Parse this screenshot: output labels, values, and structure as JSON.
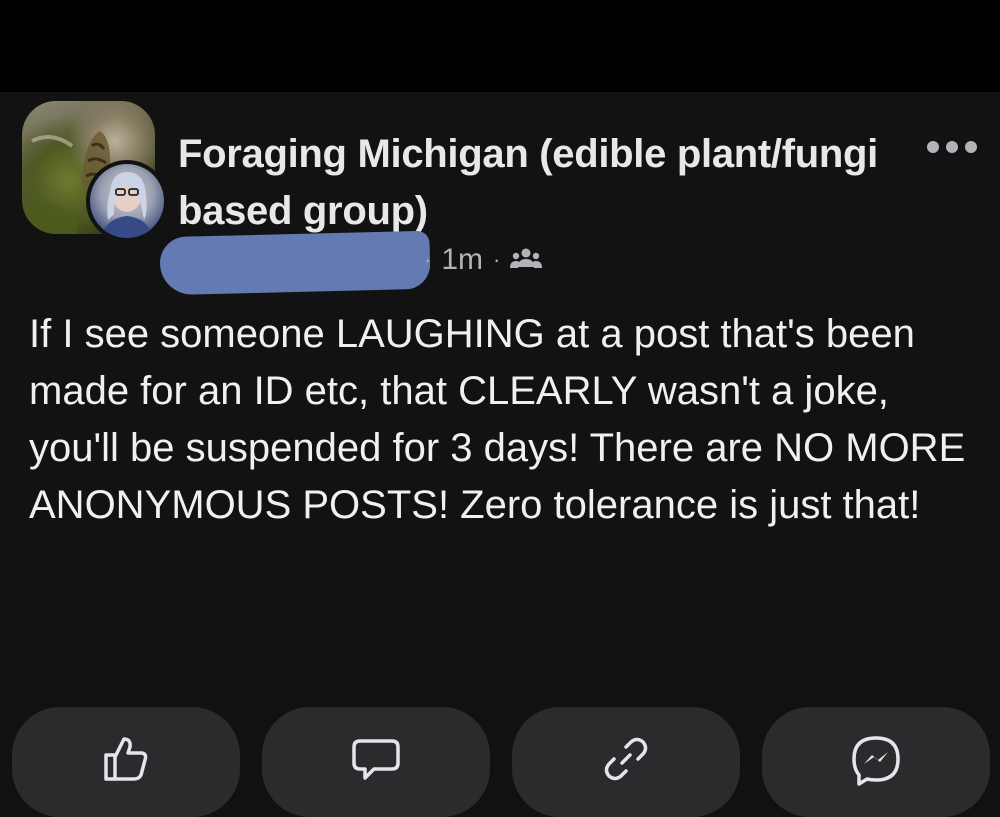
{
  "group": {
    "name": "Foraging  Michigan (edible plant/fungi based group)"
  },
  "post": {
    "time": "1m",
    "separator": "·",
    "audience_icon": "group-members-icon",
    "text": "If I see someone LAUGHING at a post that's been made for an ID etc, that CLEARLY wasn't a joke, you'll be suspended for 3 days! There are NO MORE ANONYMOUS POSTS!  Zero tolerance is just that!"
  },
  "header": {
    "more_icon": "more-options-icon"
  },
  "actions": [
    {
      "icon": "like-icon"
    },
    {
      "icon": "comment-icon"
    },
    {
      "icon": "share-link-icon"
    },
    {
      "icon": "messenger-icon"
    }
  ],
  "colors": {
    "background": "#121212",
    "top_bar": "#000000",
    "redaction": "#647ab2",
    "action_button": "#2a2b2d",
    "meta_text": "#b0b3b8"
  }
}
